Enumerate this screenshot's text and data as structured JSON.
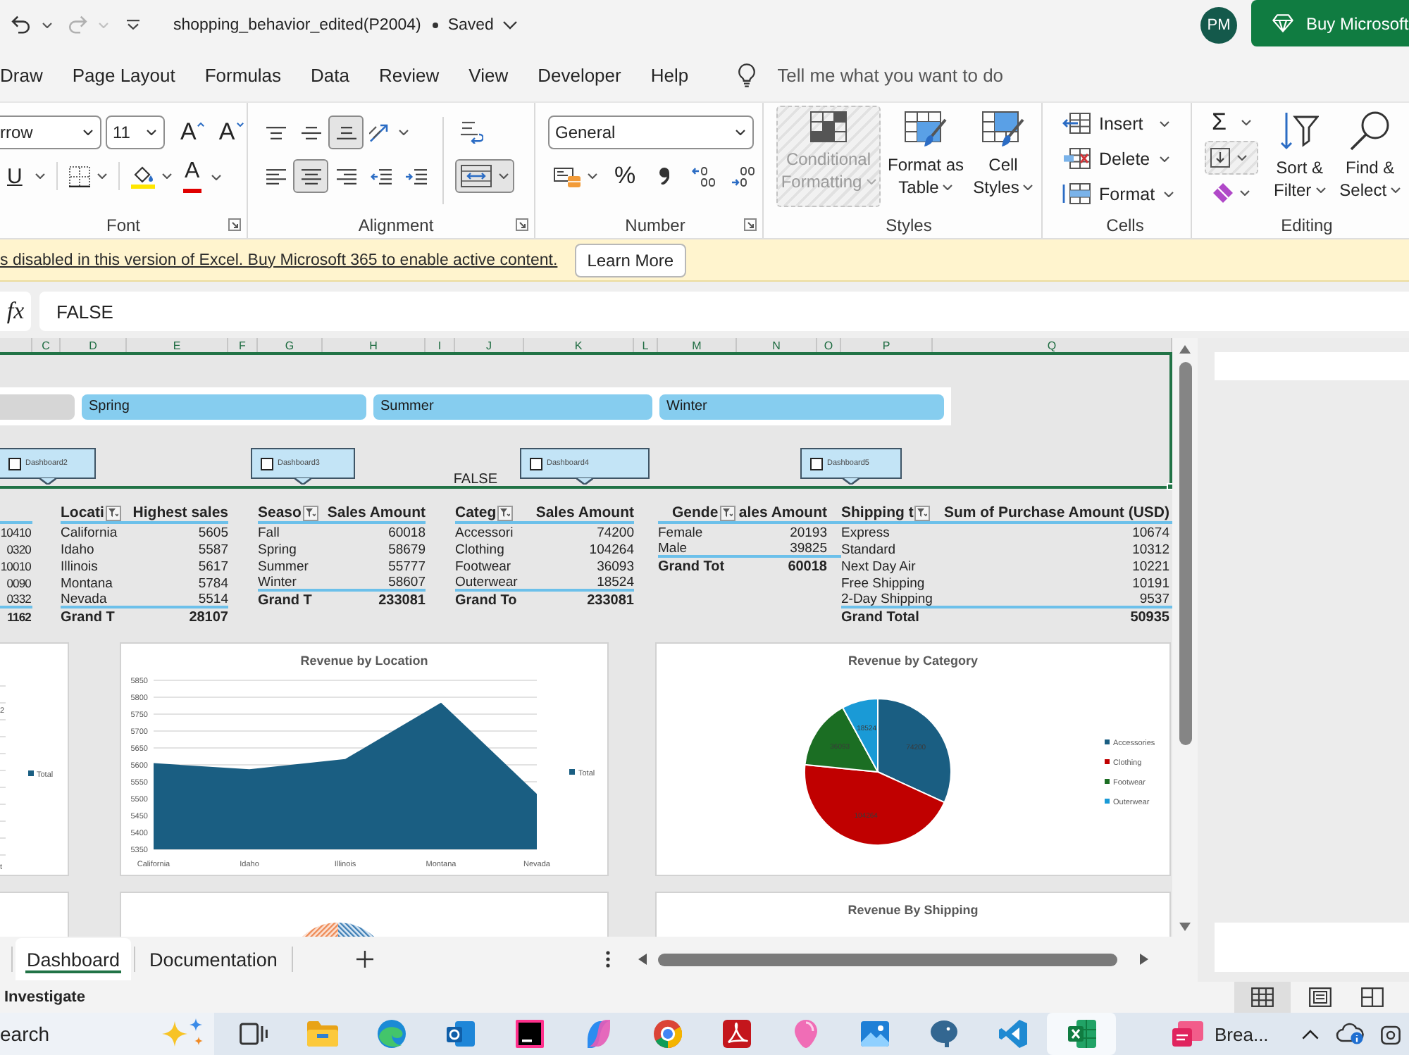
{
  "title_bar": {
    "document_title": "shopping_behavior_edited(P2004)",
    "save_state": "Saved",
    "avatar": "PM",
    "buy_button": "Buy Microsoft"
  },
  "ribbon_tabs": [
    {
      "label": "Draw",
      "selected": false
    },
    {
      "label": "Page Layout",
      "selected": false
    },
    {
      "label": "Formulas",
      "selected": false
    },
    {
      "label": "Data",
      "selected": false
    },
    {
      "label": "Review",
      "selected": false
    },
    {
      "label": "View",
      "selected": false
    },
    {
      "label": "Developer",
      "selected": false
    },
    {
      "label": "Help",
      "selected": false
    }
  ],
  "tell_me": {
    "placeholder": "Tell me what you want to do"
  },
  "ribbon": {
    "font": {
      "label": "Font",
      "font_name": "rrow",
      "font_size": "11",
      "grow": "A",
      "shrink": "A",
      "underline": "U",
      "color_letter": "A"
    },
    "alignment": {
      "label": "Alignment",
      "vertical": [
        {
          "kind": "top",
          "selected": false
        },
        {
          "kind": "middle",
          "selected": false
        },
        {
          "kind": "bottom",
          "selected": true
        }
      ],
      "horizontal": [
        {
          "kind": "left",
          "selected": false
        },
        {
          "kind": "center",
          "selected": true
        },
        {
          "kind": "right",
          "selected": false
        }
      ],
      "merge_selected": true
    },
    "number": {
      "label": "Number",
      "format": "General",
      "percent": "%"
    },
    "styles": {
      "label": "Styles",
      "buttons": [
        {
          "kind": "conditional",
          "lines": [
            "Conditional",
            "Formatting"
          ],
          "disabled": true
        },
        {
          "kind": "table",
          "lines": [
            "Format as",
            "Table"
          ],
          "disabled": false
        },
        {
          "kind": "cell_styles",
          "lines": [
            "Cell",
            "Styles"
          ],
          "disabled": false
        }
      ]
    },
    "cells": {
      "label": "Cells",
      "buttons": [
        {
          "kind": "insert",
          "label": "Insert"
        },
        {
          "kind": "delete",
          "label": "Delete"
        },
        {
          "kind": "format",
          "label": "Format"
        }
      ]
    },
    "editing": {
      "label": "Editing",
      "sum": "Σ",
      "fill_disabled": true,
      "buttons": [
        {
          "kind": "sort",
          "lines": [
            "Sort &",
            "Filter"
          ]
        },
        {
          "kind": "find",
          "lines": [
            "Find &",
            "Select"
          ]
        }
      ]
    }
  },
  "message_bar": {
    "text": "s disabled in this version of Excel. Buy Microsoft 365 to enable active content.",
    "button": "Learn More"
  },
  "formula_bar": {
    "function_label": "fx",
    "value": "FALSE"
  },
  "sheet": {
    "columns": [
      "C",
      "D",
      "E",
      "F",
      "G",
      "H",
      "I",
      "J",
      "K",
      "L",
      "M",
      "N",
      "O",
      "P",
      "Q"
    ],
    "slicer": [
      {
        "selected": false
      },
      {
        "label": "Spring",
        "selected": true
      },
      {
        "label": "Summer",
        "selected": true
      },
      {
        "label": "Winter",
        "selected": true
      }
    ],
    "shapes": [
      {
        "label": "Dashboard2",
        "checked": false
      },
      {
        "label": "Dashboard3",
        "checked": false
      },
      {
        "label": "Dashboard4",
        "checked": false
      },
      {
        "label": "Dashboard5",
        "checked": false
      }
    ],
    "cell_value": "FALSE",
    "pivots": [
      {
        "rows": [
          {
            "value": "10410"
          },
          {
            "value": "0320"
          },
          {
            "value": "10010"
          },
          {
            "value": "0090"
          },
          {
            "value": "0332"
          }
        ],
        "total": {
          "value": "1162"
        }
      },
      {
        "headers": [
          "Locati",
          "Highest sales"
        ],
        "rows": [
          {
            "label": "California",
            "value": "5605"
          },
          {
            "label": "Idaho",
            "value": "5587"
          },
          {
            "label": "Illinois",
            "value": "5617"
          },
          {
            "label": "Montana",
            "value": "5784"
          },
          {
            "label": "Nevada",
            "value": "5514"
          }
        ],
        "total": {
          "label": "Grand T",
          "value": "28107"
        }
      },
      {
        "headers": [
          "Seaso",
          "Sales Amount"
        ],
        "rows": [
          {
            "label": "Fall",
            "value": "60018"
          },
          {
            "label": "Spring",
            "value": "58679"
          },
          {
            "label": "Summer",
            "value": "55777"
          },
          {
            "label": "Winter",
            "value": "58607"
          }
        ],
        "total": {
          "label": "Grand T",
          "value": "233081"
        }
      },
      {
        "headers": [
          "Categ",
          "Sales Amount"
        ],
        "rows": [
          {
            "label": "Accessori",
            "value": "74200"
          },
          {
            "label": "Clothing",
            "value": "104264"
          },
          {
            "label": "Footwear",
            "value": "36093"
          },
          {
            "label": "Outerwear",
            "value": "18524"
          }
        ],
        "total": {
          "label": "Grand To",
          "value": "233081"
        }
      },
      {
        "headers": [
          "Gende",
          "ales Amount"
        ],
        "rows": [
          {
            "label": "Female",
            "value": "20193"
          },
          {
            "label": "Male",
            "value": "39825"
          }
        ],
        "total": {
          "label": "Grand Tot",
          "value": "60018"
        }
      },
      {
        "headers": [
          "Shipping t",
          "Sum of Purchase Amount (USD)"
        ],
        "rows": [
          {
            "label": "Express",
            "value": "10674"
          },
          {
            "label": "Standard",
            "value": "10312"
          },
          {
            "label": "Next Day Air",
            "value": "10221"
          },
          {
            "label": "Free Shipping",
            "value": "10191"
          },
          {
            "label": "2-Day Shipping",
            "value": "9537"
          }
        ],
        "total": {
          "label": "Grand Total",
          "value": "50935"
        }
      }
    ],
    "charts_top": [
      {
        "kind": "partial",
        "legend": "Total",
        "axis_fragments": [
          "2",
          "t"
        ]
      },
      {
        "kind": "chart",
        "chart_data": {
          "type": "area",
          "title": "Revenue by Location",
          "categories": [
            "California",
            "Idaho",
            "Illinois",
            "Montana",
            "Nevada"
          ],
          "series": [
            {
              "name": "Total",
              "color": "#1a5e82",
              "values": [
                5605,
                5587,
                5617,
                5784,
                5514
              ]
            }
          ],
          "ylim": [
            5350,
            5850
          ],
          "yticks": [
            5350,
            5400,
            5450,
            5500,
            5550,
            5600,
            5650,
            5700,
            5750,
            5800,
            5850
          ],
          "grid": true,
          "legend": "right"
        }
      },
      {
        "kind": "chart",
        "chart_data": {
          "type": "pie",
          "title": "Revenue by Category",
          "categories": [
            "Accessories",
            "Clothing",
            "Footwear",
            "Outerwear"
          ],
          "values": [
            74200,
            104264,
            36093,
            18524
          ],
          "colors": [
            "#1a5e82",
            "#c00000",
            "#1b6e23",
            "#1a9ad6"
          ],
          "data_labels": true,
          "legend": "right"
        }
      }
    ],
    "charts_bottom": [
      {
        "kind": "blank"
      },
      {
        "kind": "donut_partial"
      },
      {
        "kind": "title_only",
        "title": "Revenue By Shipping"
      }
    ]
  },
  "sheet_tabs": [
    {
      "label": "Dashboard",
      "selected": true
    },
    {
      "label": "Documentation",
      "selected": false
    }
  ],
  "status_bar": {
    "text": "Investigate",
    "views": [
      {
        "kind": "normal",
        "selected": true
      },
      {
        "kind": "page_layout",
        "selected": false
      },
      {
        "kind": "page_break",
        "selected": false
      }
    ]
  },
  "taskbar": {
    "search": {
      "placeholder": "earch"
    },
    "apps": [
      {
        "kind": "task_view",
        "selected": false
      },
      {
        "kind": "folder",
        "selected": false
      },
      {
        "kind": "wave",
        "selected": false
      },
      {
        "kind": "mail",
        "selected": false
      },
      {
        "kind": "dark_tile",
        "selected": false
      },
      {
        "kind": "swirl",
        "selected": false
      },
      {
        "kind": "circle",
        "selected": false
      },
      {
        "kind": "pdf",
        "selected": false
      },
      {
        "kind": "balloon",
        "selected": false
      },
      {
        "kind": "picture",
        "selected": false
      },
      {
        "kind": "elephant",
        "selected": false
      },
      {
        "kind": "ribbon",
        "selected": false
      },
      {
        "kind": "spreadsheet",
        "selected": true
      }
    ],
    "widget": "Brea..."
  }
}
